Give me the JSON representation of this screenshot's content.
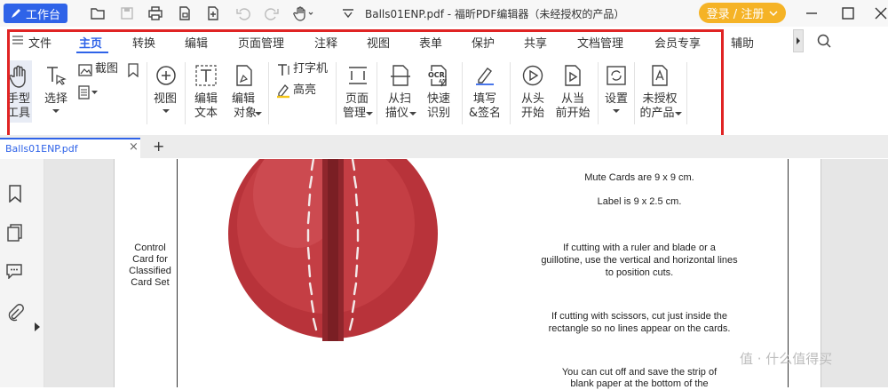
{
  "titlebar": {
    "workbench_label": "工作台",
    "doc_title": "Balls01ENP.pdf - 福昕PDF编辑器（未经授权的产品）",
    "login_label": "登录 / 注册",
    "colors": {
      "accent": "#2f63e8",
      "login": "#f5b326",
      "highlight_box": "#e02424"
    }
  },
  "menu": {
    "file_label": "文件",
    "tabs": [
      "主页",
      "转换",
      "编辑",
      "页面管理",
      "注释",
      "视图",
      "表单",
      "保护",
      "共享",
      "文档管理",
      "会员专享",
      "辅助"
    ],
    "active_tab": "主页"
  },
  "ribbon": {
    "hand_tool": [
      "手型",
      "工具"
    ],
    "select": "选择",
    "screenshot": "截图",
    "view": "视图",
    "edit_text": [
      "编辑",
      "文本"
    ],
    "edit_object": [
      "编辑",
      "对象"
    ],
    "typewriter": "打字机",
    "highlight": "高亮",
    "page_manage": [
      "页面",
      "管理"
    ],
    "scan": [
      "从扫",
      "描仪"
    ],
    "ocr": [
      "快速",
      "识别"
    ],
    "fill_sign": [
      "填写",
      "&签名"
    ],
    "from_start": [
      "从头",
      "开始"
    ],
    "from_current": [
      "从当",
      "前开始"
    ],
    "settings": "设置",
    "unlicensed": [
      "未授权",
      "的产品"
    ],
    "ocr_badge": "OCR"
  },
  "document": {
    "tab_name": "Balls01ENP.pdf",
    "left_text": [
      "Control",
      "Card for",
      "Classified",
      "Card Set"
    ],
    "right_text": {
      "size1": "Mute Cards are 9 x 9 cm.",
      "size2": "Label is 9 x 2.5 cm.",
      "cut_ruler": [
        "If cutting with a ruler and blade or a",
        "guillotine, use the vertical and horizontal lines",
        "to position cuts."
      ],
      "cut_scissors": [
        "If cutting with scissors, cut just inside the",
        "rectangle so no lines appear on the cards."
      ],
      "cut_off": [
        "You can cut off and save the strip of",
        "blank paper at the bottom of the"
      ]
    }
  },
  "watermark": "值 · 什么值得买"
}
